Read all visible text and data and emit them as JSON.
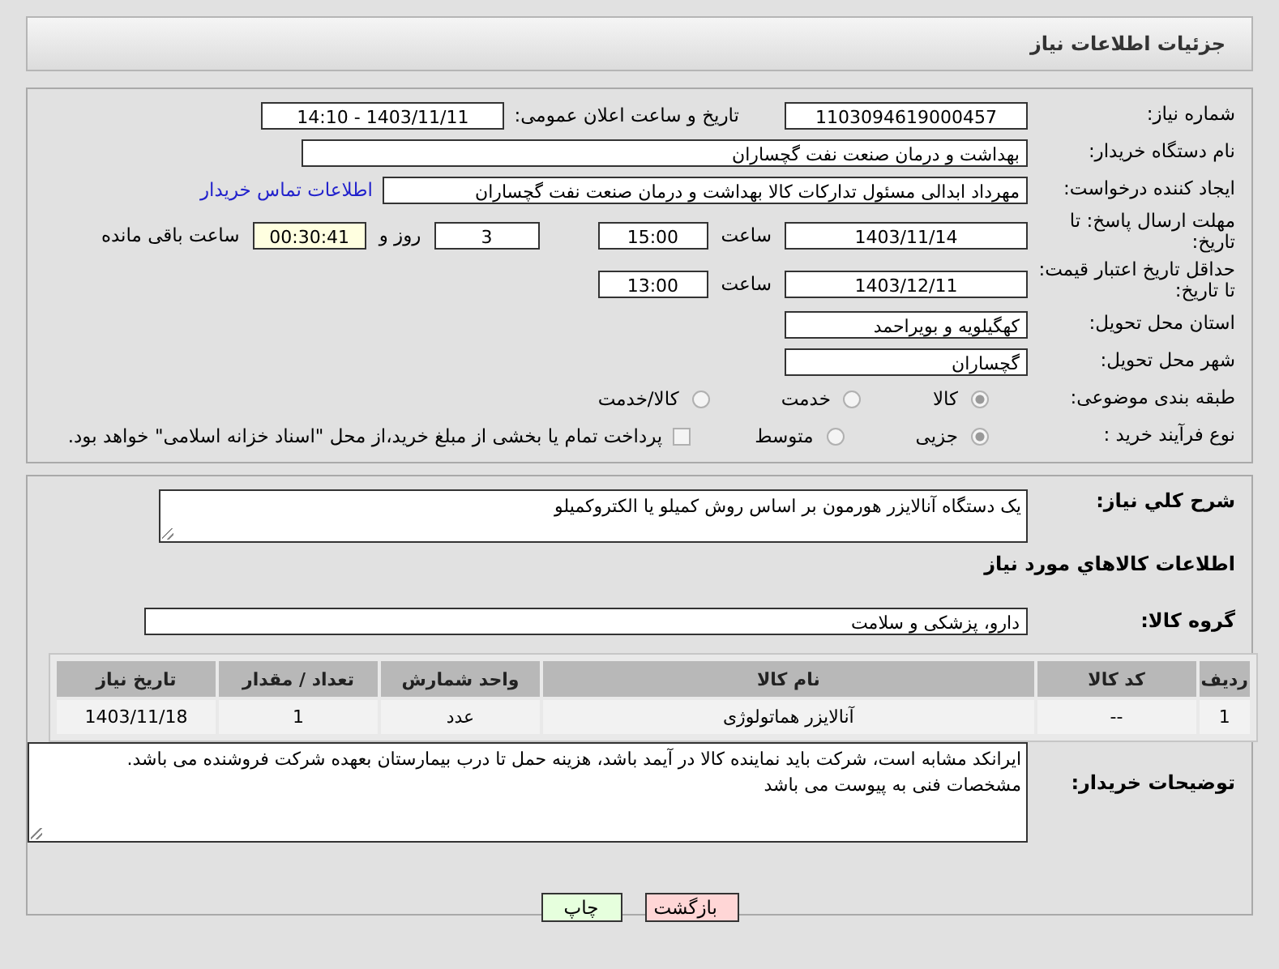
{
  "header": {
    "title": "جزئیات اطلاعات نیاز"
  },
  "need_number": {
    "label": "شماره نیاز:",
    "value": "1103094619000457"
  },
  "announce_date": {
    "label": "تاريخ و ساعت اعلان عمومی:",
    "value": "1403/11/11 - 14:10"
  },
  "buyer_org": {
    "label": "نام دستگاه خریدار:",
    "value": "بهداشت و درمان صنعت نفت گچساران"
  },
  "requester": {
    "label": "ایجاد کننده درخواست:",
    "value": "مهرداد ابدالی مسئول تدارکات کالا  بهداشت و درمان صنعت نفت گچساران",
    "link": "اطلاعات تماس خریدار"
  },
  "reply_deadline": {
    "label": "مهلت ارسال پاسخ: تا تاریخ:",
    "date": "1403/11/14",
    "time_label": "ساعت",
    "time": "15:00",
    "days": "3",
    "days_label": "روز و",
    "remaining": "00:30:41",
    "remaining_label": "ساعت باقی مانده"
  },
  "price_validity": {
    "label": "حداقل تاریخ اعتبار قیمت: تا تاریخ:",
    "date": "1403/12/11",
    "time_label": "ساعت",
    "time": "13:00"
  },
  "province": {
    "label": "استان محل تحویل:",
    "value": "کهگیلویه و بویراحمد"
  },
  "city": {
    "label": "شهر محل تحویل:",
    "value": "گچساران"
  },
  "category": {
    "label": "طبقه بندی موضوعی:",
    "options": [
      {
        "label": "کالا",
        "selected": true
      },
      {
        "label": "خدمت",
        "selected": false
      },
      {
        "label": "کالا/خدمت",
        "selected": false
      }
    ]
  },
  "process": {
    "label": "نوع فرآیند خرید :",
    "options": [
      {
        "label": "جزیی",
        "selected": true
      },
      {
        "label": "متوسط",
        "selected": false
      }
    ],
    "treasury": {
      "label": "پرداخت تمام یا بخشی از مبلغ خرید،از محل \"اسناد خزانه اسلامی\" خواهد بود.",
      "checked": false
    }
  },
  "description": {
    "label": "شرح کلي نياز:",
    "value": "یک دستگاه آنالایزر هورمون بر اساس روش کمیلو یا الکتروکمیلو"
  },
  "goods_title": "اطلاعات كالاهاي مورد نياز",
  "goods_group": {
    "label": "گروه کالا:",
    "value": "دارو، پزشکی و سلامت"
  },
  "table": {
    "columns": [
      "ردیف",
      "کد کالا",
      "نام کالا",
      "واحد شمارش",
      "تعداد / مقدار",
      "تاریخ نیاز"
    ],
    "rows": [
      [
        "1",
        "--",
        "آنالایزر هماتولوژی",
        "عدد",
        "1",
        "1403/11/18"
      ]
    ]
  },
  "buyer_notes": {
    "label": "توضیحات خریدار:",
    "value": "ایرانکد مشابه است، شرکت باید نماینده کالا در آیمد باشد، هزینه حمل تا درب بیمارستان بعهده شرکت فروشنده می باشد.\nمشخصات فنی به پیوست می باشد"
  },
  "buttons": [
    {
      "label": "بازگشت",
      "kind": "back"
    },
    {
      "label": "چاپ",
      "kind": "print"
    }
  ]
}
